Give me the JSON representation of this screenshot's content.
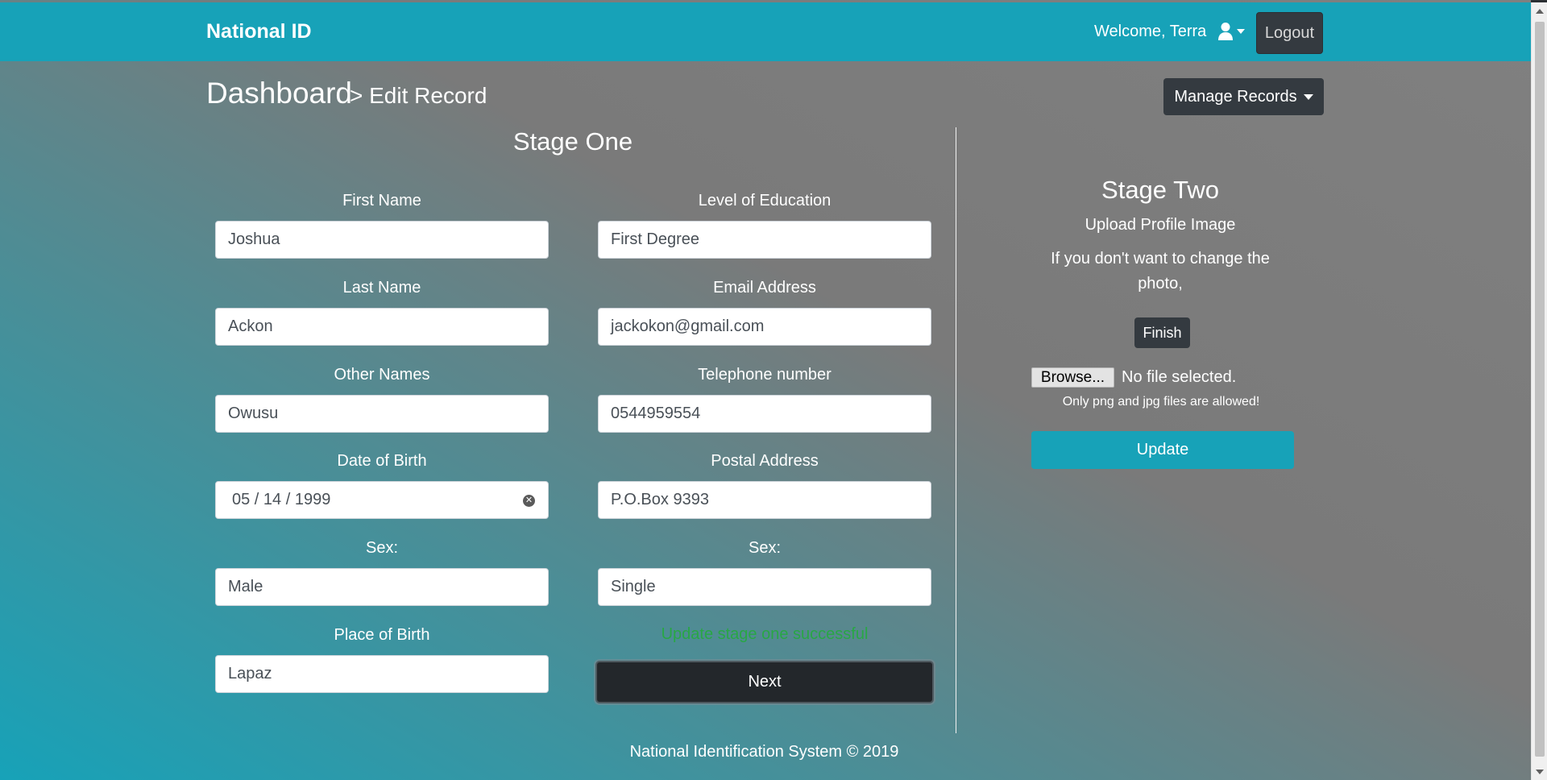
{
  "navbar": {
    "brand": "National ID",
    "welcome": "Welcome, Terra",
    "logout_label": "Logout"
  },
  "header": {
    "dashboard": "Dashboard",
    "current_page": "> Edit Record",
    "manage_records_label": "Manage Records"
  },
  "stage_one": {
    "title": "Stage One",
    "fields": {
      "first_name": {
        "label": "First Name",
        "value": "Joshua"
      },
      "last_name": {
        "label": "Last Name",
        "value": "Ackon"
      },
      "other_names": {
        "label": "Other Names",
        "value": "Owusu"
      },
      "date_of_birth": {
        "label": "Date of Birth",
        "value": "05 / 14 / 1999"
      },
      "sex": {
        "label": "Sex:",
        "value": "Male"
      },
      "place_of_birth": {
        "label": "Place of Birth",
        "value": "Lapaz"
      },
      "level_of_education": {
        "label": "Level of Education",
        "value": "First Degree"
      },
      "email_address": {
        "label": "Email Address",
        "value": "jackokon@gmail.com"
      },
      "telephone_number": {
        "label": "Telephone number",
        "value": "0544959554"
      },
      "postal_address": {
        "label": "Postal Address",
        "value": "P.O.Box 9393"
      },
      "marital_status": {
        "label": "Sex:",
        "value": "Single"
      }
    },
    "success_message": "Update stage one successful",
    "next_label": "Next"
  },
  "stage_two": {
    "title": "Stage Two",
    "upload_label": "Upload Profile Image",
    "note": "If you don't want to change the photo,",
    "finish_label": "Finish",
    "browse_label": "Browse...",
    "file_status": "No file selected.",
    "file_hint": "Only png and jpg files are allowed!",
    "update_label": "Update"
  },
  "footer": {
    "text": "National Identification System © 2019"
  },
  "colors": {
    "navbar": "#17a2b8",
    "dark_button": "#343a40",
    "success_text": "#28a745",
    "update_button": "#17a2b8"
  },
  "icons": {
    "user_menu": "user-icon",
    "dob_clear": "clear-circle-icon"
  }
}
